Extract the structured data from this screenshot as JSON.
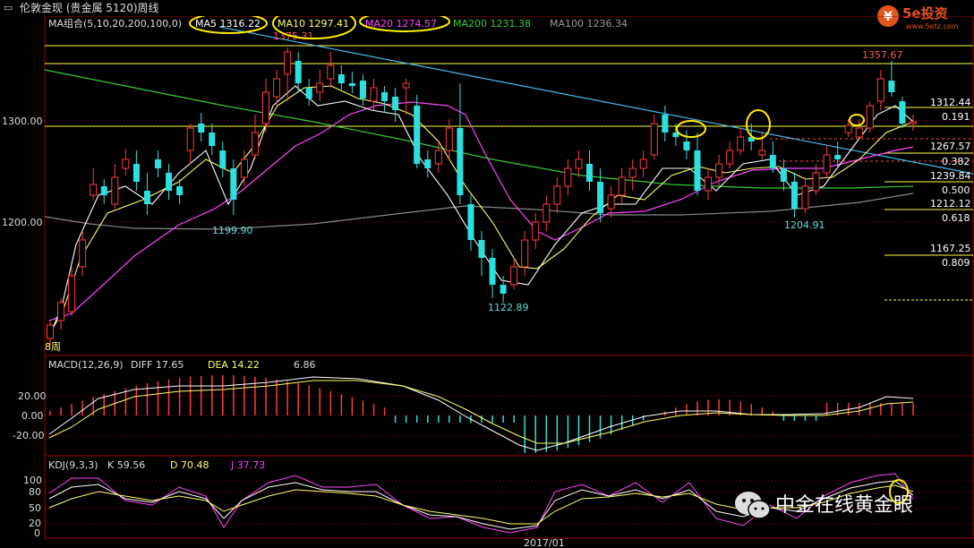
{
  "window": {
    "title": "伦敦金现 (贵金属 5120)周线"
  },
  "logo": {
    "brand": "5e投资",
    "url": "www.5etz.com"
  },
  "watermark": {
    "text": "中金在线黄金眼"
  },
  "main_panel": {
    "legend": {
      "group": "MA组合(5,10,20,200,100,0)",
      "ma5": "MA5 1316.22",
      "ma10": "MA10 1297.41",
      "ma20": "MA20 1274.57",
      "ma200": "MA200 1231.38",
      "ma100": "MA100 1236.34"
    },
    "y_ticks": [
      "1300.00",
      "1200.00"
    ],
    "price_labels": {
      "high1": "1375.31",
      "low1": "1199.90",
      "low2": "1122.89",
      "low3": "1204.91",
      "high2": "1357.67",
      "start": "8周"
    },
    "fib_levels": [
      {
        "price": "1312.44",
        "ratio": "0.191"
      },
      {
        "price": "1267.57",
        "ratio": "0.382"
      },
      {
        "price": "1239.84",
        "ratio": "0.500"
      },
      {
        "price": "1212.12",
        "ratio": "0.618"
      },
      {
        "price": "1167.25",
        "ratio": "0.809"
      }
    ]
  },
  "macd_panel": {
    "label": "MACD(12,26,9)",
    "diff": "DIFF  17.65",
    "dea": "DEA  14.22",
    "macd": "6.86",
    "y_ticks": [
      "20.00",
      "0.00",
      "-20.00"
    ]
  },
  "kdj_panel": {
    "label": "KDJ(9,3,3)",
    "k": "K  59.56",
    "d": "D  70.48",
    "j": "J  37.73",
    "y_ticks": [
      "100",
      "80",
      "50",
      "20",
      "0"
    ]
  },
  "x_axis": {
    "label": "2017/01"
  },
  "colors": {
    "up": "#ff3b3b",
    "down": "#2de0e0",
    "ma5": "#ffffff",
    "ma10": "#ffff66",
    "ma20": "#ff44ff",
    "ma200": "#33cc33",
    "ma100": "#999999",
    "trend": "#44bbee",
    "fib": "#ffff44",
    "highlight": "#ffee00"
  }
}
